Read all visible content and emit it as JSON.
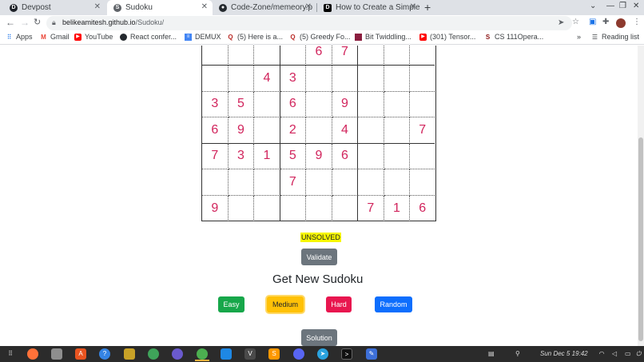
{
  "browser": {
    "tabs": [
      {
        "title": "Devpost",
        "favicon": "devpost-icon",
        "favicon_color": "#1d2128"
      },
      {
        "title": "Sudoku",
        "favicon": "github-pages-icon",
        "favicon_color": "#5f6368"
      },
      {
        "title": "Code-Zone/memeory.p",
        "favicon": "github-icon",
        "favicon_color": "#24292e"
      },
      {
        "title": "How to Create a Simple",
        "favicon": "dev-icon",
        "favicon_color": "#000000"
      }
    ],
    "new_tab_label": "+",
    "url_host": "belikeamitesh.github.io",
    "url_path": "/Sudoku/",
    "bookmarks": [
      {
        "label": "Apps",
        "icon": "apps-grid-icon"
      },
      {
        "label": "Gmail",
        "icon": "gmail-icon"
      },
      {
        "label": "YouTube",
        "icon": "youtube-icon"
      },
      {
        "label": "React confer...",
        "icon": "github-icon"
      },
      {
        "label": "DEMUX",
        "icon": "doc-icon"
      },
      {
        "label": "(5) Here is a...",
        "icon": "quora-icon"
      },
      {
        "label": "(5) Greedy Fo...",
        "icon": "quora-icon"
      },
      {
        "label": "Bit Twiddling...",
        "icon": "bookmark-icon"
      },
      {
        "label": "(301) Tensor...",
        "icon": "youtube-icon"
      },
      {
        "label": "CS 111Opera...",
        "icon": "stanford-icon"
      }
    ],
    "more_bookmarks": "»",
    "reading_list": "Reading list"
  },
  "sudoku": {
    "grid": [
      [
        "",
        "",
        "",
        "",
        "6",
        "7",
        "",
        "",
        ""
      ],
      [
        "",
        "",
        "4",
        "3",
        "",
        "",
        "",
        "",
        ""
      ],
      [
        "3",
        "5",
        "",
        "6",
        "",
        "9",
        "",
        "",
        ""
      ],
      [
        "6",
        "9",
        "",
        "2",
        "",
        "4",
        "",
        "",
        "7"
      ],
      [
        "7",
        "3",
        "1",
        "5",
        "9",
        "6",
        "",
        "",
        ""
      ],
      [
        "",
        "",
        "",
        "7",
        "",
        "",
        "",
        "",
        ""
      ],
      [
        "9",
        "",
        "",
        "",
        "",
        "",
        "7",
        "1",
        "6"
      ]
    ],
    "status": "UNSOLVED",
    "validate_label": "Validate",
    "new_heading": "Get New Sudoku",
    "easy_label": "Easy",
    "medium_label": "Medium",
    "hard_label": "Hard",
    "random_label": "Random",
    "solution_label": "Solution"
  },
  "taskbar": {
    "clock": "Sun Dec 5  19:42"
  },
  "colors": {
    "digit": "#d1245c",
    "status_bg": "#f7f700",
    "easy": "#17a74a",
    "medium": "#ffc107",
    "hard": "#e8164f",
    "random": "#0d6efd",
    "secondary": "#6c757d"
  }
}
